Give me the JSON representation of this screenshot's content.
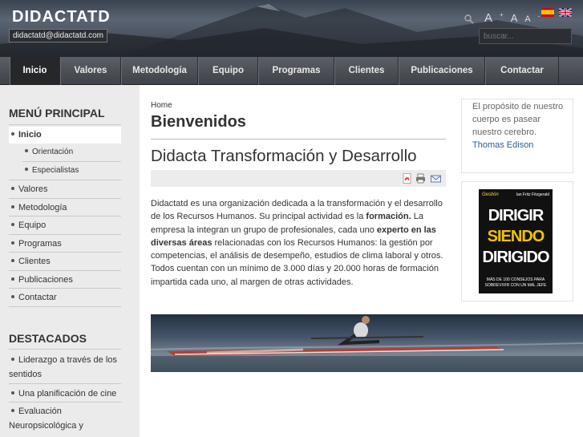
{
  "header": {
    "logo": "DIDACTATD",
    "email": "didactatd@didactatd.com",
    "font_tools": {
      "increase": "A",
      "reset": "A",
      "decrease": "A"
    },
    "search_placeholder": "buscar...",
    "languages": [
      "es",
      "en"
    ]
  },
  "nav": {
    "items": [
      {
        "label": "Inicio",
        "active": true
      },
      {
        "label": "Valores"
      },
      {
        "label": "Metodología"
      },
      {
        "label": "Equipo"
      },
      {
        "label": "Programas"
      },
      {
        "label": "Clientes"
      },
      {
        "label": "Publicaciones"
      },
      {
        "label": "Contactar"
      }
    ]
  },
  "sidebar": {
    "menu_title": "MENÚ PRINCIPAL",
    "menu_items": [
      {
        "label": "Inicio",
        "active": true
      },
      {
        "label": "Orientación",
        "sub": true
      },
      {
        "label": "Especialistas",
        "sub": true
      },
      {
        "label": "Valores"
      },
      {
        "label": "Metodología"
      },
      {
        "label": "Equipo"
      },
      {
        "label": "Programas"
      },
      {
        "label": "Clientes"
      },
      {
        "label": "Publicaciones"
      },
      {
        "label": "Contactar"
      }
    ],
    "featured_title": "DESTACADOS",
    "featured_items": [
      {
        "line1": "Liderazgo a través de los",
        "line2": "sentidos"
      },
      {
        "line1": "Una planificación de cine",
        "line2": ""
      },
      {
        "line1": "Evaluación",
        "line2": "Neuropsicológica y"
      }
    ]
  },
  "main": {
    "breadcrumb": "Home",
    "page_title": "Bienvenidos",
    "article_title": "Didacta Transformación y Desarrollo",
    "body": {
      "p1": "Didactatd es una organización dedicada a la transformación y el desarrollo de los Recursos Humanos. Su principal actividad es la ",
      "b1": "formación.",
      "p2": " La empresa la integran un grupo de profesionales, cada uno ",
      "b2": "experto en las diversas áreas",
      "p3": " relacionadas con los Recursos Humanos: la gestión por competencias, el análisis de desempeño, estudios de clima laboral y otros. Todos cuentan con un mínimo de 3.000 días y 20.000 horas de formación impartida cada uno, al margen de otras actividades."
    },
    "icons": [
      "pdf-icon",
      "print-icon",
      "email-icon"
    ]
  },
  "right": {
    "quote": "El propósito de nuestro cuerpo es pasear nuestro cerebro.",
    "quote_author": "Thomas Edison",
    "book": {
      "top_left": "Gestión",
      "top_right": "Ian Fritz Fitzgerald",
      "line1": "DIRIGIR",
      "line2": "SIENDO",
      "line3": "DIRIGIDO",
      "sub1": "MÁS DE 100 CONSEJOS PARA",
      "sub2": "SOBREVIVIR CON UN MAL JEFE"
    }
  },
  "colors": {
    "nav_bg": "#4a4d53",
    "sidebar_bg": "#ebebeb",
    "accent_link": "#2f5d8a"
  }
}
